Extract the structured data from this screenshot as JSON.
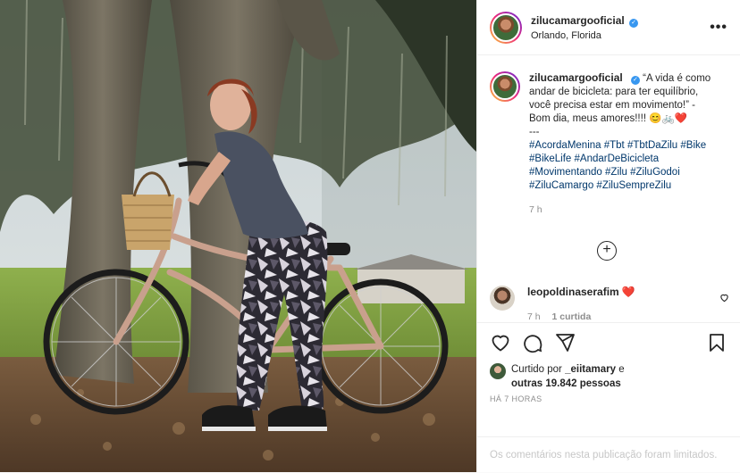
{
  "post": {
    "username": "zilucamargooficial",
    "location": "Orlando, Florida",
    "more_label": "•••",
    "caption": {
      "text": "“A vida é como andar de bicicleta: para ter equilíbrio, você precisa estar em movimento!” - Bom dia, meus amores!!!! 😊🚲❤️",
      "separator": "---",
      "hashtags": "#AcordaMenina #Tbt #TbtDaZilu #Bike #BikeLife #AndarDeBicicleta #Movimentando #Zilu #ZiluGodoi #ZiluCamargo #ZiluSempreZilu",
      "time": "7 h"
    },
    "load_more_label": "+",
    "comment": {
      "username": "leopoldinaserafim",
      "text": "❤️",
      "time": "7 h",
      "likes": "1 curtida"
    },
    "liked_by": {
      "prefix": "Curtido por",
      "user": "_eiitamary",
      "middle": "e",
      "others": "outras 19.842 pessoas"
    },
    "posted_ago": "HÁ 7 HORAS",
    "comments_limited": "Os comentários nesta publicação foram limitados."
  },
  "icons": {
    "like": "heart-outline-icon",
    "comment": "comment-bubble-icon",
    "share": "paper-plane-icon",
    "save": "bookmark-icon",
    "verified": "verified-badge-icon"
  },
  "colors": {
    "link": "#00376b",
    "muted": "#8e8e8e",
    "verified": "#3897f0",
    "heart": "#ed4956"
  }
}
